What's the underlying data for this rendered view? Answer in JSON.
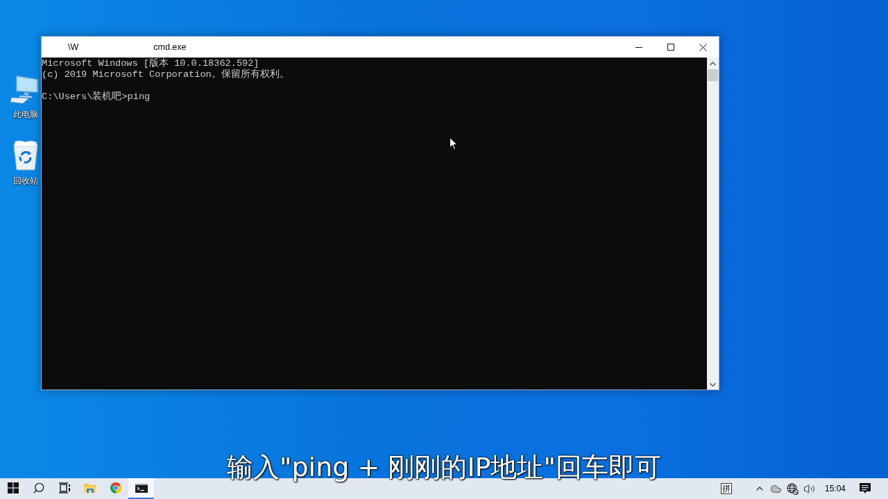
{
  "desktop": {
    "icons": [
      {
        "kind": "computer",
        "label": "此电脑"
      },
      {
        "kind": "recycle-bin",
        "label": "回收站"
      }
    ]
  },
  "window": {
    "title_fragments": [
      "\\W",
      "cmd.exe"
    ],
    "console": {
      "header_lines": [
        "Microsoft Windows [版本 10.0.18362.592]",
        "(c) 2019 Microsoft Corporation。保留所有权利。"
      ],
      "prompt_line": "C:\\Users\\装机吧>ping"
    }
  },
  "caption": "输入\"ping + 刚刚的IP地址\"回车即可",
  "taskbar": {
    "items": [
      {
        "kind": "start",
        "selected": false
      },
      {
        "kind": "search",
        "selected": false
      },
      {
        "kind": "task-view",
        "selected": false
      },
      {
        "kind": "file-explorer",
        "selected": false
      },
      {
        "kind": "browser",
        "selected": false
      },
      {
        "kind": "console",
        "selected": true
      }
    ],
    "tray": {
      "ime_indicator": "拼",
      "icons": [
        {
          "kind": "chevron"
        },
        {
          "kind": "cloud"
        },
        {
          "kind": "network"
        },
        {
          "kind": "volume"
        }
      ],
      "clock": "15:04"
    }
  }
}
